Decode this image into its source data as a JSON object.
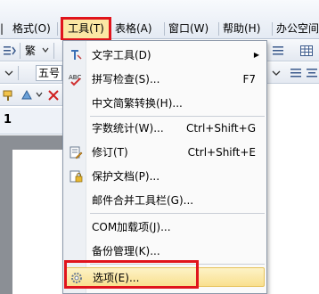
{
  "menubar": {
    "items": [
      {
        "id": "g",
        "label": "|"
      },
      {
        "id": "format",
        "label": "格式(O)"
      },
      {
        "id": "tools",
        "label": "工具(T)"
      },
      {
        "id": "table",
        "label": "表格(A)"
      },
      {
        "id": "window",
        "label": "窗口(W)"
      },
      {
        "id": "help",
        "label": "帮助(H)"
      },
      {
        "id": "office",
        "label": "办公空间"
      }
    ]
  },
  "toolbar": {
    "font_size_value": "五号",
    "traditional_label": "繁",
    "ruler_mark": "1"
  },
  "dropdown": {
    "items": [
      {
        "label": "文字工具(D)",
        "shortcut": "",
        "submenu": true,
        "icon": "text-tool-icon"
      },
      {
        "label": "拼写检查(S)...",
        "shortcut": "F7",
        "submenu": false,
        "icon": "spellcheck-icon"
      },
      {
        "label": "中文简繁转换(H)...",
        "shortcut": "",
        "submenu": false,
        "icon": ""
      },
      {
        "label": "字数统计(W)...",
        "shortcut": "Ctrl+Shift+G",
        "submenu": false,
        "icon": ""
      },
      {
        "label": "修订(T)",
        "shortcut": "Ctrl+Shift+E",
        "submenu": false,
        "icon": "revision-icon"
      },
      {
        "label": "保护文档(P)...",
        "shortcut": "",
        "submenu": false,
        "icon": "protect-document-icon"
      },
      {
        "label": "邮件合并工具栏(G)...",
        "shortcut": "",
        "submenu": false,
        "icon": ""
      },
      {
        "label": "COM加载项(J)...",
        "shortcut": "",
        "submenu": false,
        "icon": ""
      },
      {
        "label": "备份管理(K)...",
        "shortcut": "",
        "submenu": false,
        "icon": ""
      },
      {
        "label": "选项(E)...",
        "shortcut": "",
        "submenu": false,
        "icon": "options-gear-icon"
      }
    ],
    "highlighted_index": 9
  },
  "colors": {
    "highlight_frame": "#e0141c",
    "hover_fill": "#f9e08f"
  }
}
